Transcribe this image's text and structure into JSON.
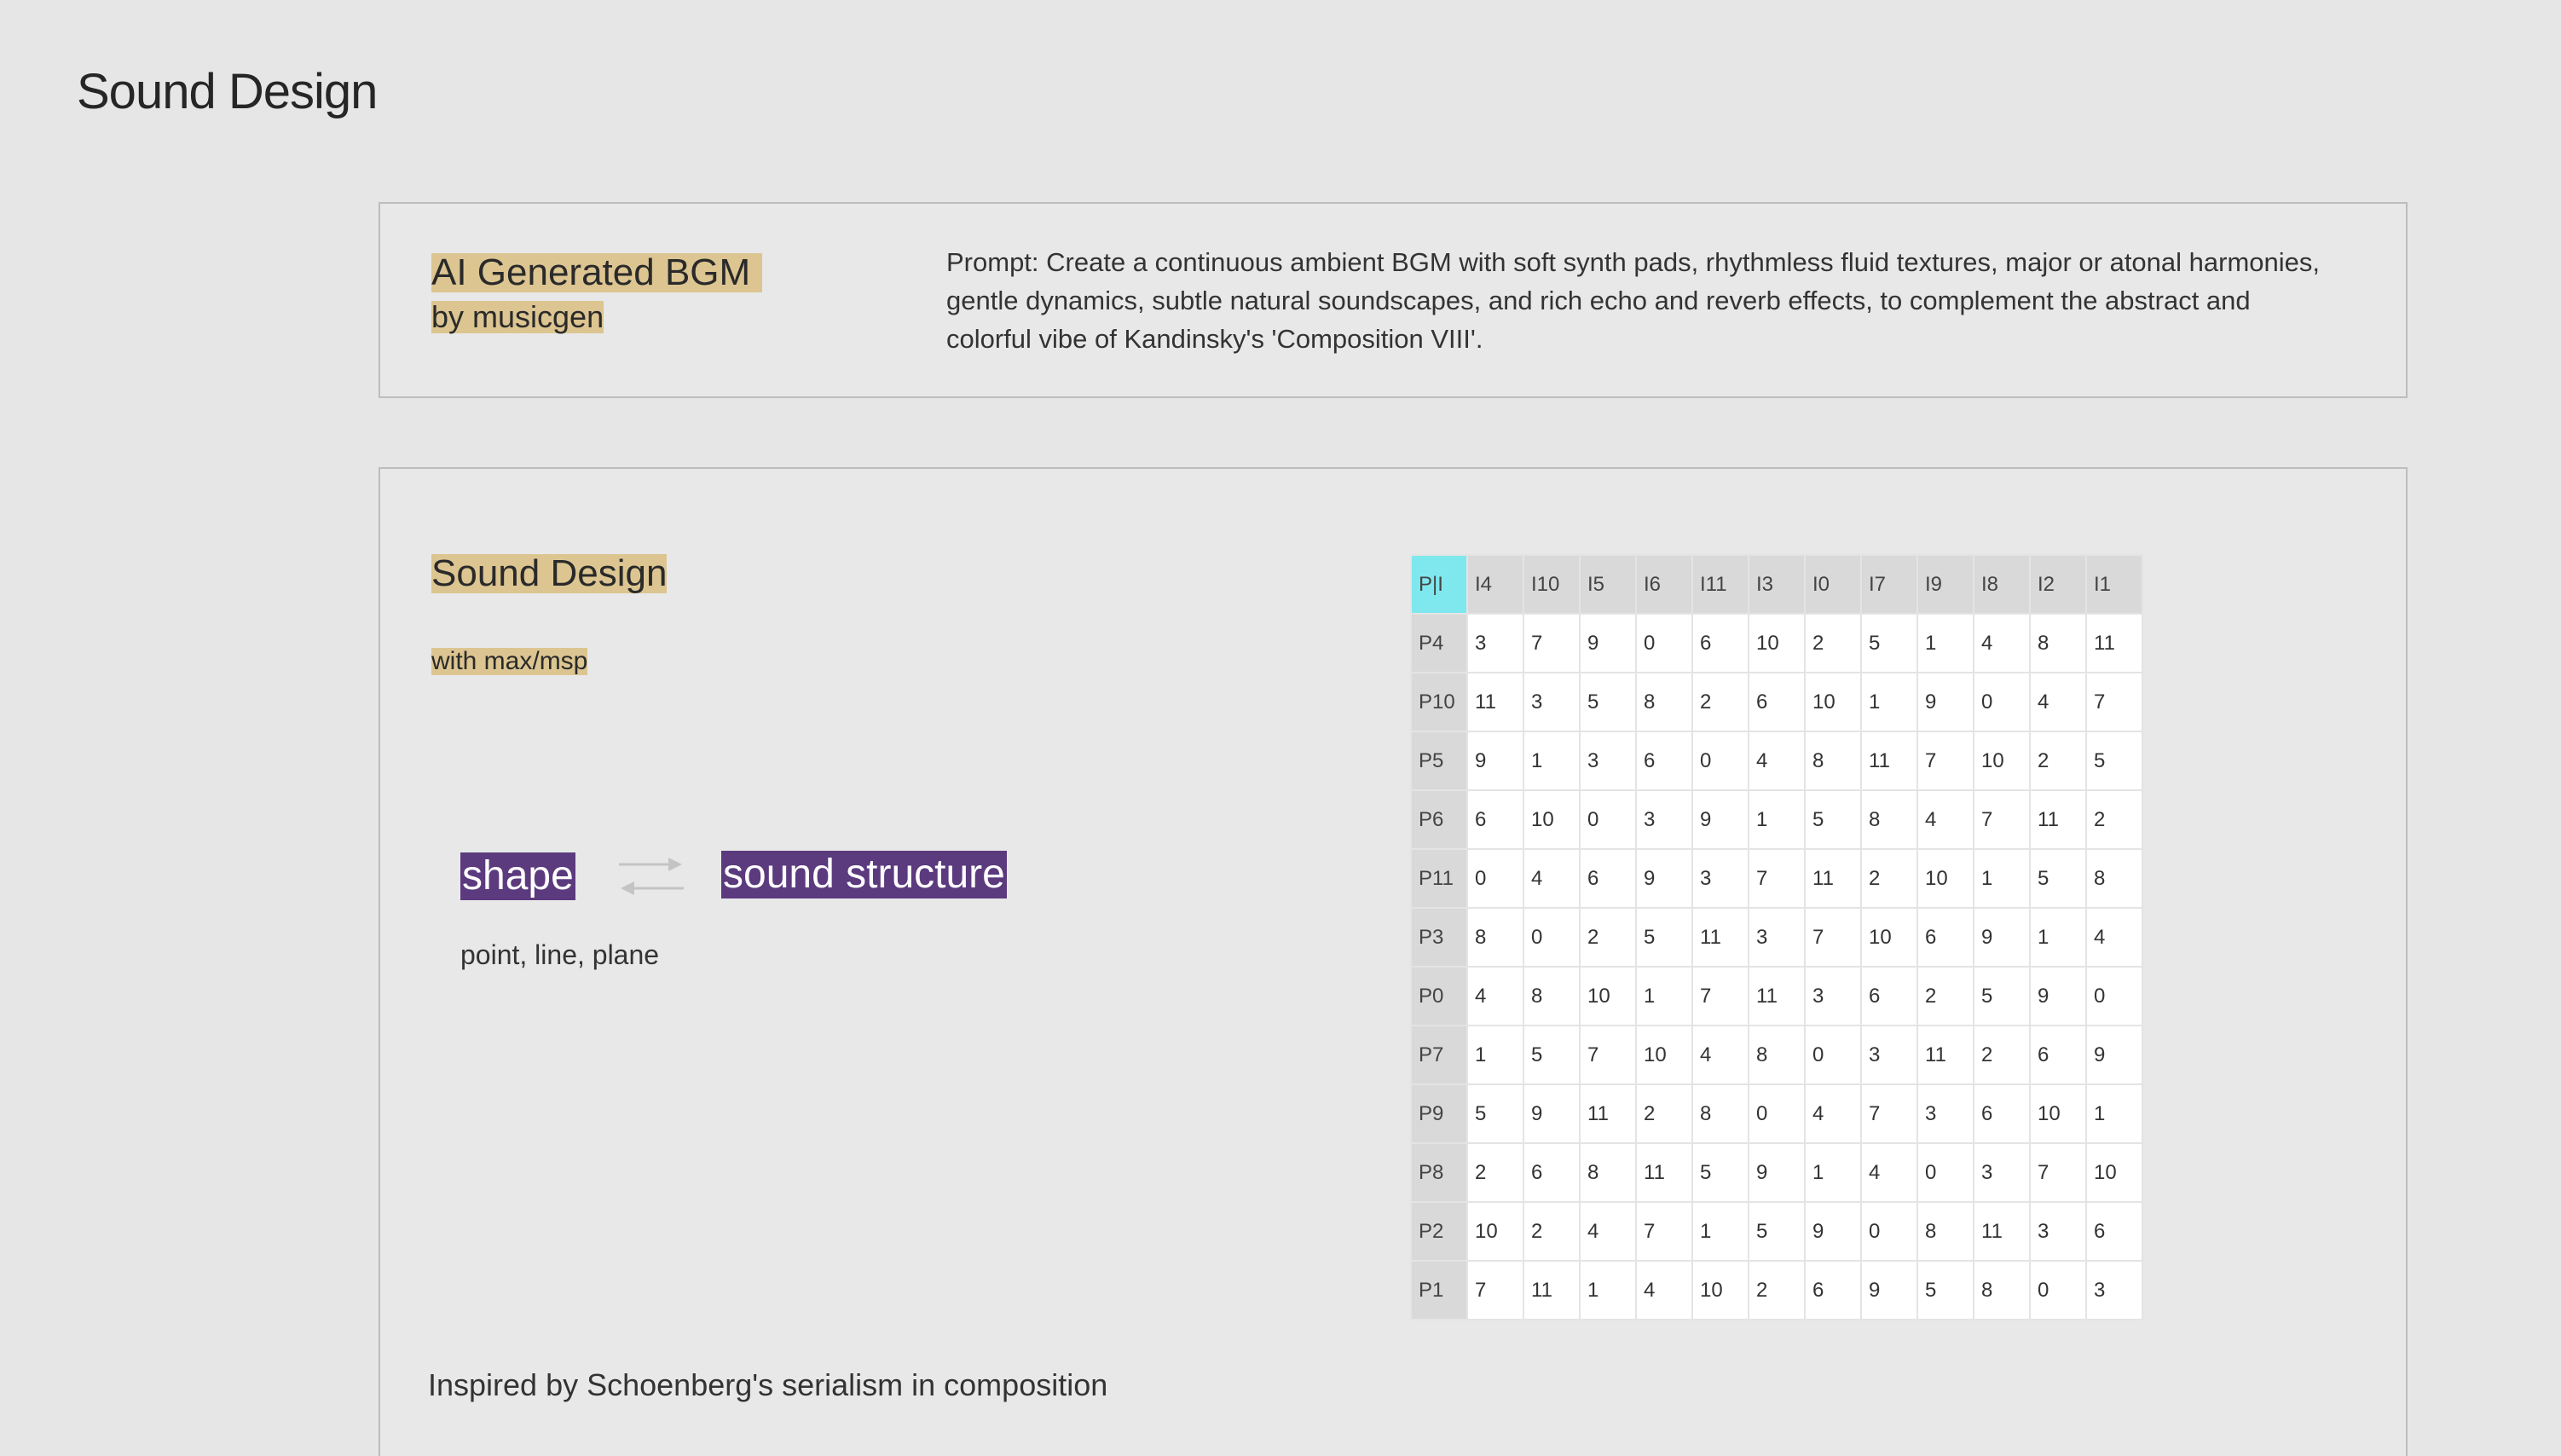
{
  "page": {
    "title": "Sound Design"
  },
  "bgm": {
    "title": "AI Generated BGM",
    "subtitle": "by musicgen",
    "prompt": "Prompt: Create a continuous ambient BGM with soft synth pads, rhythmless fluid textures, major or atonal harmonies, gentle dynamics, subtle natural soundscapes, and rich echo and reverb effects, to complement the abstract and colorful vibe of Kandinsky's 'Composition VIII'."
  },
  "sound_design": {
    "title": "Sound Design",
    "subtitle": "with max/msp",
    "shape_label": "shape",
    "structure_label": "sound structure",
    "elements_label": "point, line, plane",
    "inspired": "Inspired by Schoenberg's serialism in composition",
    "colors": {
      "highlight": "#dcc591",
      "chip": "#5b3a7e",
      "corner": "#7fe8ee"
    }
  },
  "matrix": {
    "corner": "P|I",
    "columns": [
      "I4",
      "I10",
      "I5",
      "I6",
      "I11",
      "I3",
      "I0",
      "I7",
      "I9",
      "I8",
      "I2",
      "I1"
    ],
    "rows": [
      {
        "label": "P4",
        "values": [
          "3",
          "7",
          "9",
          "0",
          "6",
          "10",
          "2",
          "5",
          "1",
          "4",
          "8",
          "11"
        ]
      },
      {
        "label": "P10",
        "values": [
          "11",
          "3",
          "5",
          "8",
          "2",
          "6",
          "10",
          "1",
          "9",
          "0",
          "4",
          "7"
        ]
      },
      {
        "label": "P5",
        "values": [
          "9",
          "1",
          "3",
          "6",
          "0",
          "4",
          "8",
          "11",
          "7",
          "10",
          "2",
          "5"
        ]
      },
      {
        "label": "P6",
        "values": [
          "6",
          "10",
          "0",
          "3",
          "9",
          "1",
          "5",
          "8",
          "4",
          "7",
          "11",
          "2"
        ]
      },
      {
        "label": "P11",
        "values": [
          "0",
          "4",
          "6",
          "9",
          "3",
          "7",
          "11",
          "2",
          "10",
          "1",
          "5",
          "8"
        ]
      },
      {
        "label": "P3",
        "values": [
          "8",
          "0",
          "2",
          "5",
          "11",
          "3",
          "7",
          "10",
          "6",
          "9",
          "1",
          "4"
        ]
      },
      {
        "label": "P0",
        "values": [
          "4",
          "8",
          "10",
          "1",
          "7",
          "11",
          "3",
          "6",
          "2",
          "5",
          "9",
          "0"
        ]
      },
      {
        "label": "P7",
        "values": [
          "1",
          "5",
          "7",
          "10",
          "4",
          "8",
          "0",
          "3",
          "11",
          "2",
          "6",
          "9"
        ]
      },
      {
        "label": "P9",
        "values": [
          "5",
          "9",
          "11",
          "2",
          "8",
          "0",
          "4",
          "7",
          "3",
          "6",
          "10",
          "1"
        ]
      },
      {
        "label": "P8",
        "values": [
          "2",
          "6",
          "8",
          "11",
          "5",
          "9",
          "1",
          "4",
          "0",
          "3",
          "7",
          "10"
        ]
      },
      {
        "label": "P2",
        "values": [
          "10",
          "2",
          "4",
          "7",
          "1",
          "5",
          "9",
          "0",
          "8",
          "11",
          "3",
          "6"
        ]
      },
      {
        "label": "P1",
        "values": [
          "7",
          "11",
          "1",
          "4",
          "10",
          "2",
          "6",
          "9",
          "5",
          "8",
          "0",
          "3"
        ]
      }
    ]
  }
}
